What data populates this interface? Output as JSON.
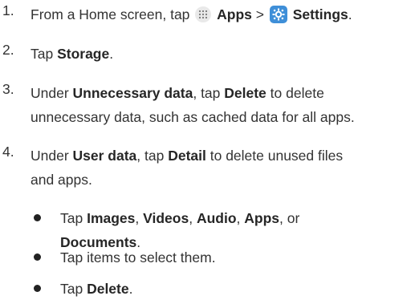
{
  "steps": [
    {
      "number": "1.",
      "parts": [
        "From a Home screen, tap ",
        "Apps",
        " > ",
        "Settings",
        "."
      ],
      "icons": [
        "apps-icon",
        "settings-icon"
      ]
    },
    {
      "number": "2.",
      "parts": [
        "Tap ",
        "Storage",
        "."
      ]
    },
    {
      "number": "3.",
      "line1": [
        "Under ",
        "Unnecessary data",
        ", tap ",
        "Delete",
        " to delete"
      ],
      "line2": "unnecessary data, such as cached data for all apps."
    },
    {
      "number": "4.",
      "line1": [
        "Under ",
        "User data",
        ", tap ",
        "Detail",
        " to delete unused files"
      ],
      "line2": "and apps."
    }
  ],
  "bullets": [
    {
      "line1": [
        "Tap ",
        "Images",
        ", ",
        "Videos",
        ", ",
        "Audio",
        ", ",
        "Apps",
        ", or"
      ],
      "line2": [
        "Documents",
        "."
      ]
    },
    {
      "text": "Tap items to select them."
    },
    {
      "parts": [
        "Tap ",
        "Delete",
        "."
      ]
    }
  ]
}
